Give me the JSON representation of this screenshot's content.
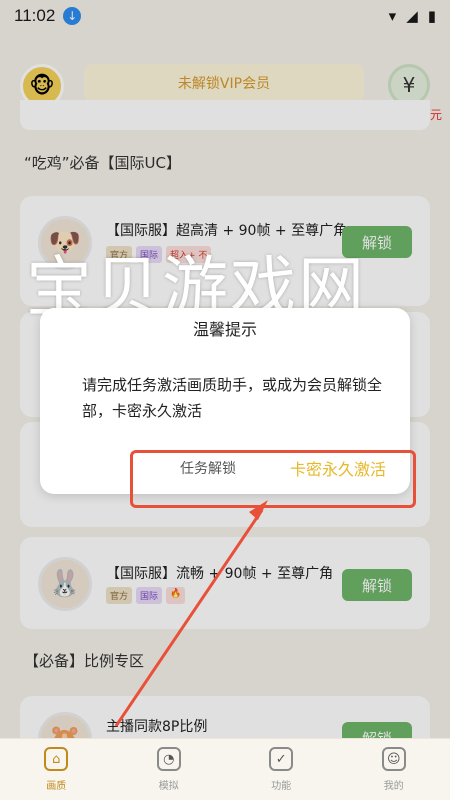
{
  "status": {
    "time": "11:02",
    "download_glyph": "↓",
    "wifi": "▾",
    "signal": "◢",
    "battery": "▮"
  },
  "header": {
    "vip_label": "未解锁VIP会员",
    "avatar_emoji": "🐵",
    "money_glyph": "¥",
    "yuan_label": "元"
  },
  "sections": [
    {
      "title": "“吃鸡”必备【国际UC】"
    },
    {
      "title": "【必备】比例专区"
    }
  ],
  "cards": [
    {
      "title": "【国际服】超高清 + 90帧 + 至尊广角",
      "tags": [
        "官方",
        "国际"
      ],
      "extra_tag": "超入+ 不",
      "button": "解锁"
    },
    {
      "title": "【国际服】流畅 + 90帧 + 至尊广角",
      "tags": [
        "官方",
        "国际"
      ],
      "extra_tag": "🔥",
      "button": "解锁"
    },
    {
      "title": "主播同款8P比例",
      "button": "解锁"
    }
  ],
  "watermark": "宝贝游戏网",
  "dialog": {
    "title": "温馨提示",
    "message": "请完成任务激活画质助手，或成为会员解锁全部，卡密永久激活",
    "task_button": "任务解锁",
    "card_button": "卡密永久激活"
  },
  "nav": [
    {
      "label": "画质",
      "icon": "⌂",
      "active": true
    },
    {
      "label": "模拟",
      "icon": "◔",
      "active": false
    },
    {
      "label": "功能",
      "icon": "✓",
      "active": false
    },
    {
      "label": "我的",
      "icon": "☺",
      "active": false
    }
  ],
  "colors": {
    "accent": "#e7b82a",
    "annotation": "#e8503a",
    "unlock_green": "#6fb56a"
  }
}
